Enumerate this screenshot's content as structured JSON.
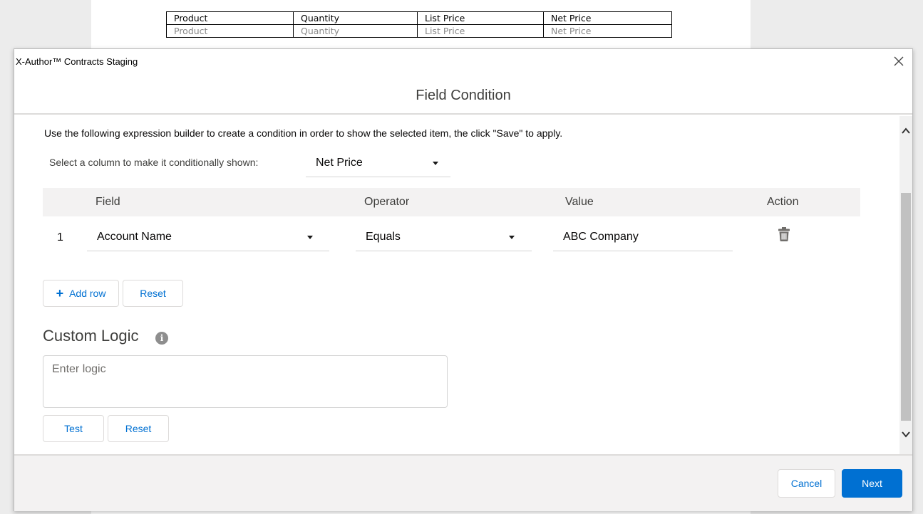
{
  "background_table": {
    "headers": [
      "Product",
      "Quantity",
      "List Price",
      "Net Price"
    ],
    "row": [
      "Product",
      "Quantity",
      "List Price",
      "Net Price"
    ]
  },
  "window": {
    "title": "X-Author™ Contracts Staging",
    "close_icon": "close-icon"
  },
  "modal": {
    "title": "Field Condition",
    "instructions": "Use the following expression builder to create a condition in order to show the selected item, the click \"Save\" to apply.",
    "column_select": {
      "label": "Select a column to make it conditionally shown:",
      "value": "Net Price"
    },
    "condition_table": {
      "headers": {
        "field": "Field",
        "operator": "Operator",
        "value": "Value",
        "action": "Action"
      },
      "rows": [
        {
          "number": "1",
          "field": "Account Name",
          "operator": "Equals",
          "value": "ABC Company",
          "action_icon": "trash-icon"
        }
      ]
    },
    "add_row_label": "Add row",
    "reset_label": "Reset",
    "custom_logic": {
      "title": "Custom Logic",
      "info_icon": "info-icon",
      "placeholder": "Enter logic",
      "test_label": "Test",
      "reset_label": "Reset"
    },
    "footer": {
      "cancel_label": "Cancel",
      "next_label": "Next"
    }
  },
  "colors": {
    "brand_blue": "#0070d2",
    "header_gray": "#f3f2f2",
    "border": "#dddbda"
  }
}
